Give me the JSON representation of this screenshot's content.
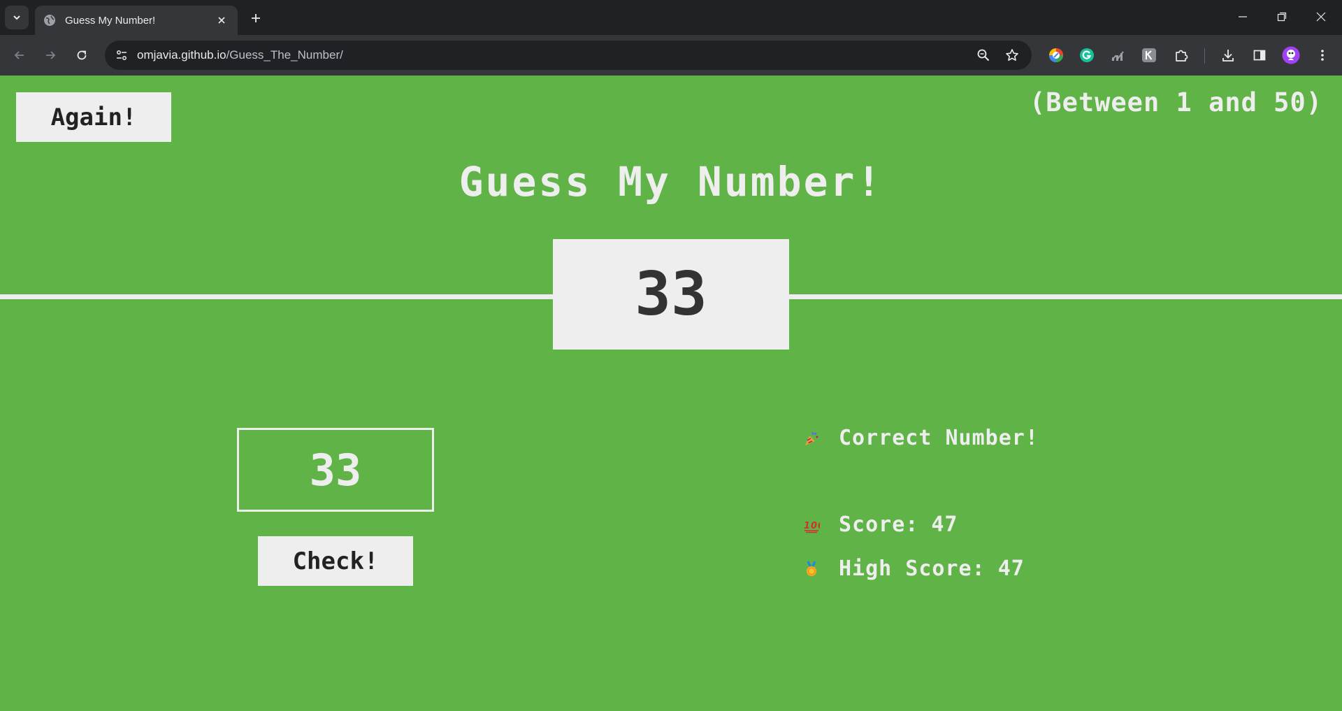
{
  "browser": {
    "tab_title": "Guess My Number!",
    "url_host": "omjavia.github.io",
    "url_path": "/Guess_The_Number/"
  },
  "game": {
    "again_label": "Again!",
    "range_text": "(Between 1 and 50)",
    "title": "Guess My Number!",
    "secret_number": "33",
    "guess_value": "33",
    "check_label": "Check!",
    "message": "Correct Number!",
    "score_label": "Score:",
    "score_value": "47",
    "highscore_label": "High Score:",
    "highscore_value": "47"
  },
  "colors": {
    "win_background": "#60b347",
    "panel": "#eeeeee",
    "dark_text": "#333333"
  }
}
